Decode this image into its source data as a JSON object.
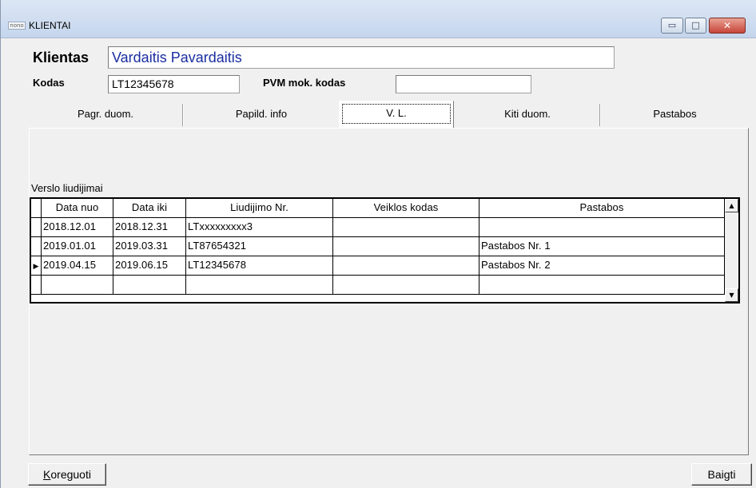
{
  "window": {
    "app_icon_text": "nono",
    "title": "KLIENTAI",
    "controls": {
      "minimize": "▭",
      "maximize": "□",
      "close": "✕"
    }
  },
  "client": {
    "name_label": "Klientas",
    "name_value": "Vardaitis Pavardaitis",
    "code_label": "Kodas",
    "code_value": "LT12345678",
    "vat_label": "PVM mok. kodas",
    "vat_value": ""
  },
  "tabs": [
    {
      "label": "Pagr. duom.",
      "active": false
    },
    {
      "label": "Papild. info",
      "active": false
    },
    {
      "label": "V. L.",
      "active": true
    },
    {
      "label": "Kiti duom.",
      "active": false
    },
    {
      "label": "Pastabos",
      "active": false
    }
  ],
  "grid": {
    "caption": "Verslo liudijimai",
    "columns": [
      "Data nuo",
      "Data iki",
      "Liudijimo Nr.",
      "Veiklos kodas",
      "Pastabos"
    ],
    "rows": [
      [
        "2018.12.01",
        "2018.12.31",
        "LTxxxxxxxxx3",
        "",
        ""
      ],
      [
        "2019.01.01",
        "2019.03.31",
        "LT87654321",
        "",
        "Pastabos Nr. 1"
      ],
      [
        "2019.04.15",
        "2019.06.15",
        "LT12345678",
        "",
        "Pastabos Nr. 2"
      ],
      [
        "",
        "",
        "",
        "",
        ""
      ]
    ],
    "current_row_indicator": "▶",
    "scroll_up": "▲",
    "scroll_down": "▼"
  },
  "footer": {
    "edit_button_accel": "K",
    "edit_button_rest": "oreguoti",
    "finish_button": "Baigti"
  }
}
